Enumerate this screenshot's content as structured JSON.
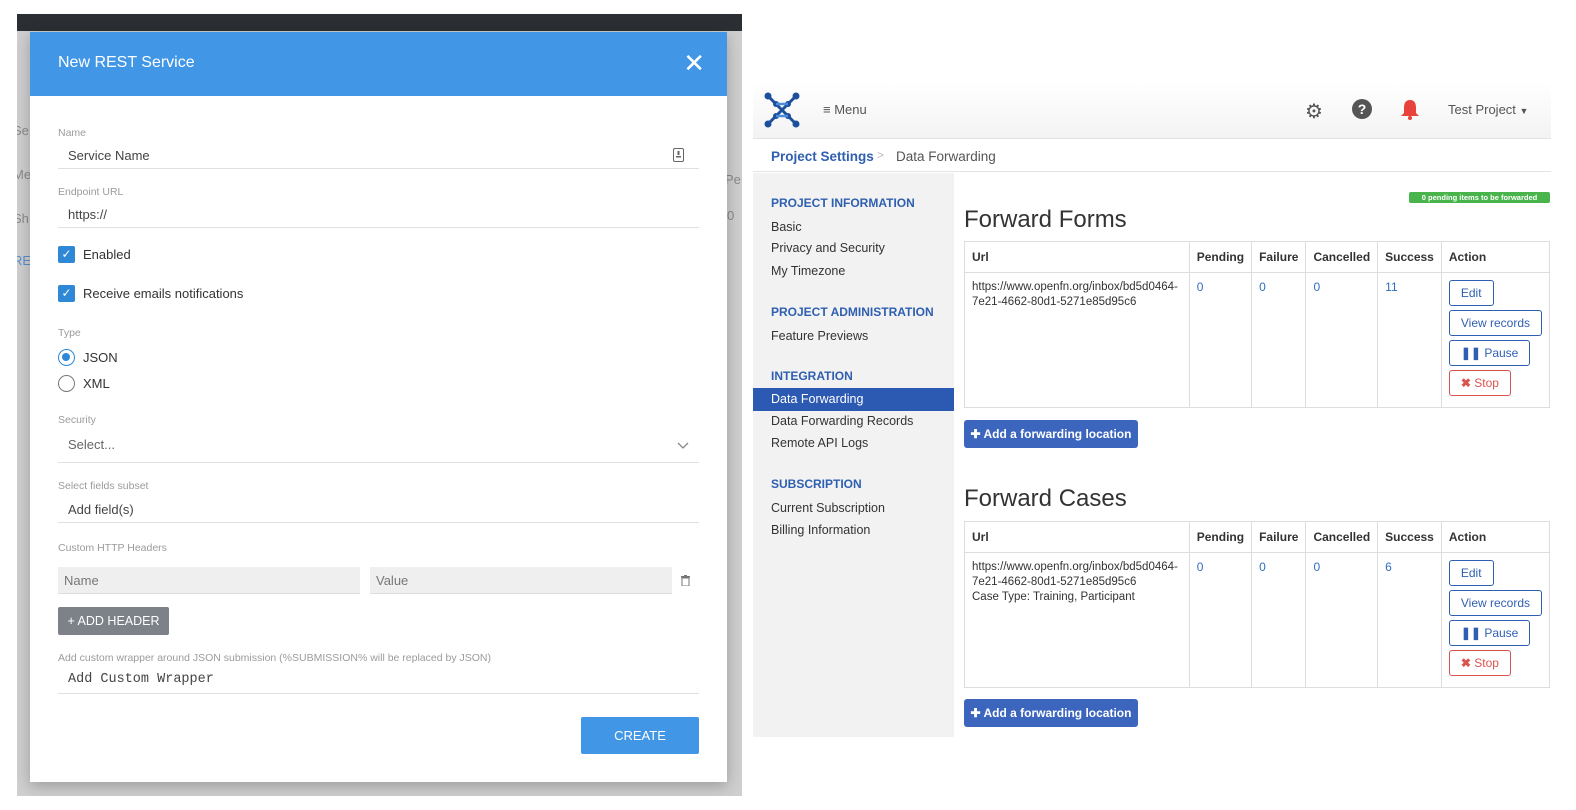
{
  "left_background": {
    "fragments": [
      "Se",
      "Me",
      "Sh",
      "RE",
      "Pe",
      "0"
    ]
  },
  "modal": {
    "title": "New REST Service",
    "name_label": "Name",
    "name_value": "Service Name",
    "endpoint_label": "Endpoint URL",
    "endpoint_value": "https://",
    "enabled_label": "Enabled",
    "emails_label": "Receive emails notifications",
    "type_label": "Type",
    "type_options": [
      "JSON",
      "XML"
    ],
    "type_selected": "JSON",
    "security_label": "Security",
    "security_placeholder": "Select...",
    "fields_label": "Select fields subset",
    "fields_placeholder": "Add field(s)",
    "headers_label": "Custom HTTP Headers",
    "header_name_placeholder": "Name",
    "header_value_placeholder": "Value",
    "add_header_label": "+ ADD HEADER",
    "wrapper_label": "Add custom wrapper around JSON submission (%SUBMISSION% will be replaced by JSON)",
    "wrapper_placeholder": "Add Custom Wrapper",
    "create_label": "CREATE"
  },
  "nav": {
    "menu_label": "Menu",
    "project_label": "Test Project",
    "icons": [
      "gear-icon",
      "help-icon",
      "bell-icon"
    ],
    "bell_color": "#e8433a"
  },
  "breadcrumb": {
    "parent": "Project Settings",
    "separator": ">",
    "current": "Data Forwarding"
  },
  "sidebar": {
    "sections": [
      {
        "heading": "PROJECT INFORMATION",
        "items": [
          "Basic",
          "Privacy and Security",
          "My Timezone"
        ]
      },
      {
        "heading": "PROJECT ADMINISTRATION",
        "items": [
          "Feature Previews"
        ]
      },
      {
        "heading": "INTEGRATION",
        "items": [
          "Data Forwarding",
          "Data Forwarding Records",
          "Remote API Logs"
        ]
      },
      {
        "heading": "SUBSCRIPTION",
        "items": [
          "Current Subscription",
          "Billing Information"
        ]
      }
    ],
    "active_item": "Data Forwarding"
  },
  "pending_badge": "0 pending items to be forwarded",
  "columns": [
    "Url",
    "Pending",
    "Failure",
    "Cancelled",
    "Success",
    "Action"
  ],
  "forms": {
    "title": "Forward Forms",
    "row": {
      "url": "https://www.openfn.org/inbox/bd5d0464-7e21-4662-80d1-5271e85d95c6",
      "extra": "",
      "pending": "0",
      "failure": "0",
      "cancelled": "0",
      "success": "11"
    }
  },
  "cases": {
    "title": "Forward Cases",
    "row": {
      "url": "https://www.openfn.org/inbox/bd5d0464-7e21-4662-80d1-5271e85d95c6",
      "extra": "Case Type: Training, Participant",
      "pending": "0",
      "failure": "0",
      "cancelled": "0",
      "success": "6"
    }
  },
  "actions": {
    "edit": "Edit",
    "view": "View records",
    "pause": "Pause",
    "stop": "Stop"
  },
  "add_location_label": "Add a forwarding location",
  "colors": {
    "modal_header": "#4196e6",
    "primary": "#2f5fb0",
    "success_badge": "#4ab44c",
    "danger": "#d9534f"
  }
}
